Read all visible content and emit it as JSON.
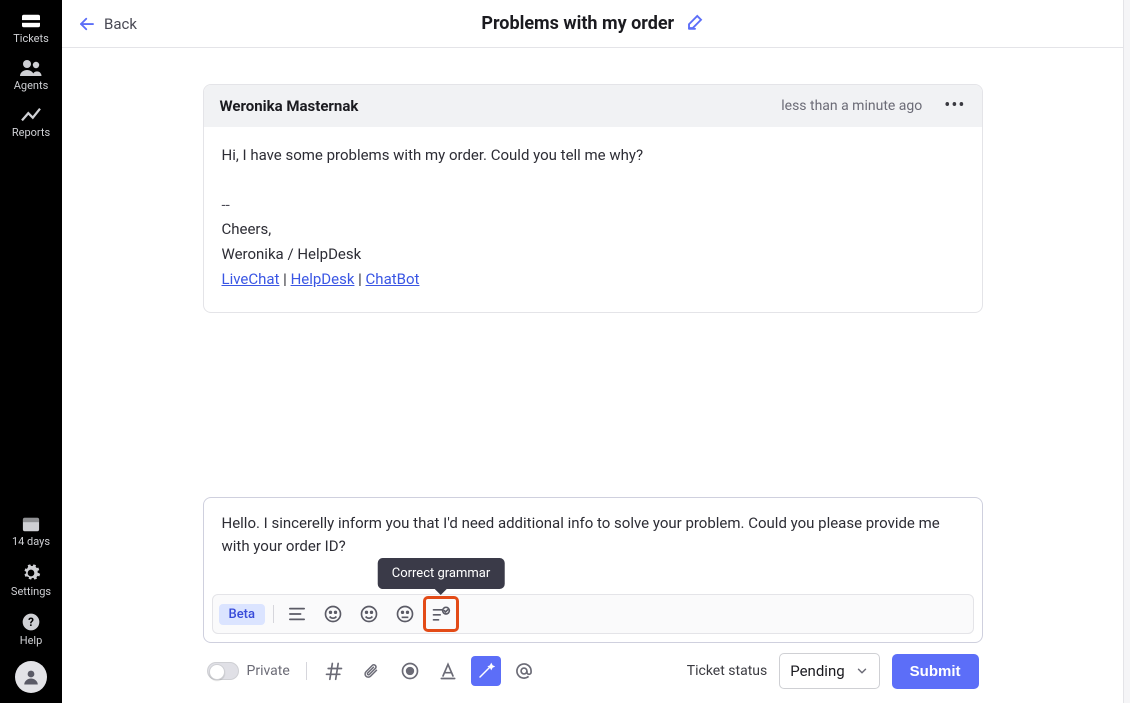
{
  "sidebar": {
    "top_items": [
      {
        "label": "Tickets",
        "icon": "tickets"
      },
      {
        "label": "Agents",
        "icon": "agents"
      },
      {
        "label": "Reports",
        "icon": "reports"
      }
    ],
    "bottom_items": [
      {
        "label": "14 days",
        "icon": "calendar"
      },
      {
        "label": "Settings",
        "icon": "gear"
      },
      {
        "label": "Help",
        "icon": "help"
      }
    ]
  },
  "header": {
    "back_label": "Back",
    "title": "Problems with my order"
  },
  "message": {
    "author": "Weronika Masternak",
    "timestamp": "less than a minute ago",
    "body_line1": "Hi, I have some problems with my order. Could you tell me why?",
    "sig_divider": "--",
    "sig_cheers": "Cheers,",
    "sig_name": "Weronika / HelpDesk",
    "links": {
      "livechat": "LiveChat",
      "helpdesk": "HelpDesk",
      "chatbot": "ChatBot",
      "sep": " | "
    }
  },
  "composer": {
    "draft": "Hello. I sincerelly inform you that I'd need additional info to solve your problem. Could you please provide me with your order ID?",
    "beta_label": "Beta",
    "tooltip": "Correct grammar"
  },
  "actions": {
    "private_label": "Private",
    "status_label": "Ticket status",
    "status_value": "Pending",
    "submit_label": "Submit"
  }
}
